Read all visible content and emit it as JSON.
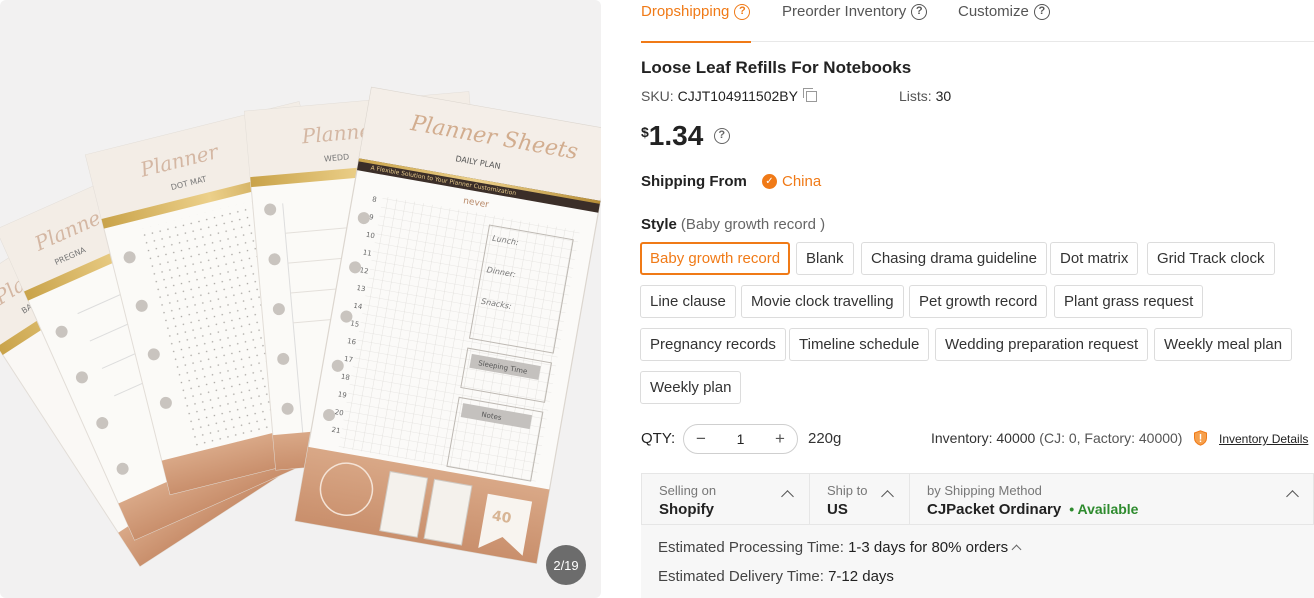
{
  "gallery": {
    "counter": "2/19",
    "sheet_labels": [
      "Planner Sheets",
      "DAILY PLAN",
      "A Flexible Solution to Your Planner Customization",
      "never",
      "Lunch:",
      "Dinner:",
      "Snacks:",
      "Sleeping Time",
      "Notes",
      "40"
    ],
    "hours": [
      "8",
      "9",
      "10",
      "11",
      "12",
      "13",
      "14",
      "15",
      "16",
      "17",
      "18",
      "19",
      "20",
      "21"
    ],
    "back_sheets": [
      "Planner Sh",
      "Planner",
      "Planner",
      "Planner",
      "Planner"
    ],
    "back_subs": [
      "BABY JOURNAL",
      "PREGNA",
      "DOT MAT",
      "WEDD"
    ]
  },
  "tabs": [
    {
      "label": "Dropshipping",
      "icon": "question-circle-icon",
      "active": true
    },
    {
      "label": "Preorder Inventory",
      "icon": "question-circle-icon",
      "active": false
    },
    {
      "label": "Customize",
      "icon": "question-circle-icon",
      "active": false
    }
  ],
  "product": {
    "title": "Loose Leaf Refills For Notebooks",
    "sku_label": "SKU:",
    "sku_value": "CJJT104911502BY",
    "lists_label": "Lists:",
    "lists_value": "30",
    "currency": "$",
    "price": "1.34"
  },
  "shipping_from": {
    "label": "Shipping From",
    "value": "China"
  },
  "style": {
    "label": "Style",
    "selected_text": "(Baby growth record )",
    "options": [
      "Baby growth record",
      "Blank",
      "Chasing drama guideline",
      "Dot matrix",
      "Grid Track clock",
      "Line clause",
      "Movie clock travelling",
      "Pet growth record",
      "Plant grass request",
      "Pregnancy records",
      "Timeline schedule",
      "Wedding preparation request",
      "Weekly meal plan",
      "Weekly plan"
    ],
    "selected_index": 0
  },
  "qty": {
    "label": "QTY:",
    "minus": "−",
    "value": "1",
    "plus": "+",
    "weight": "220g",
    "inventory": "Inventory: 40000",
    "inventory_sub": "(CJ: 0, Factory: 40000)",
    "details_link": "Inventory Details"
  },
  "shipping": {
    "selling_on_label": "Selling on",
    "selling_on_value": "Shopify",
    "ship_to_label": "Ship to",
    "ship_to_value": "US",
    "method_label": "by Shipping Method",
    "method_value": "CJPacket Ordinary",
    "availability": "• Available",
    "processing_label": "Estimated Processing Time:",
    "processing_value": "1-3 days for 80% orders",
    "delivery_label": "Estimated Delivery Time:",
    "delivery_value": "7-12 days"
  },
  "colors": {
    "accent": "#f07a17",
    "available": "#2e8b2e"
  }
}
